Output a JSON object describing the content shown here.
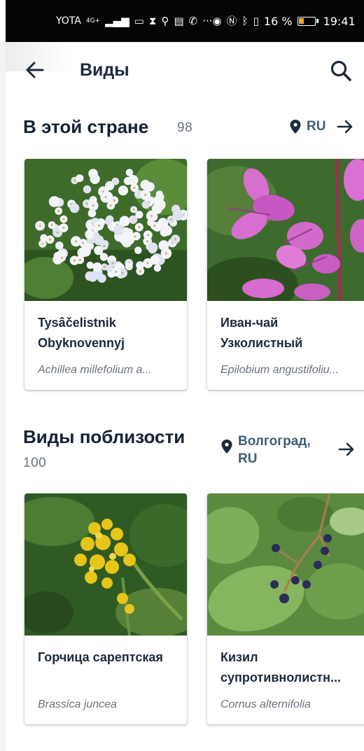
{
  "status_bar": {
    "carrier": "YOTA",
    "network": "4G+",
    "battery": "16 %",
    "time": "19:41",
    "icons": [
      "signal-icon",
      "screen-icon",
      "hourglass-icon",
      "search-icon",
      "news-icon",
      "viber-icon",
      "more-icon",
      "eye-icon",
      "nfc-icon",
      "bluetooth-icon",
      "vibrate-icon",
      "battery-icon"
    ]
  },
  "app_bar": {
    "title": "Виды",
    "back_icon": "arrow-left-icon",
    "search_icon": "search-icon"
  },
  "sections": [
    {
      "title": "В этой стране",
      "count": "98",
      "location": "RU",
      "cards": [
        {
          "common_name": "Tysâčelistnik\nObyknovennyj",
          "scientific_name": "Achillea millefolium a...",
          "photo": "white-yarrow-flowers"
        },
        {
          "common_name": "Иван-чай\nУзколистный",
          "scientific_name": "Epilobium angustifoliu...",
          "photo": "pink-fireweed-flowers"
        }
      ]
    },
    {
      "title": "Виды поблизости",
      "count": "100",
      "location": "Волгоград,\nRU",
      "cards": [
        {
          "common_name": "Горчица сарептская",
          "scientific_name": "Brassica juncea",
          "photo": "yellow-mustard-flowers"
        },
        {
          "common_name": "Кизил\nсупротивнолистн...",
          "scientific_name": "Cornus alternifolia",
          "photo": "dogwood-berries"
        }
      ]
    }
  ],
  "colors": {
    "title": "#142233",
    "muted": "#6b7380",
    "link": "#3f5d75",
    "status_bar_bg": "#050505"
  }
}
